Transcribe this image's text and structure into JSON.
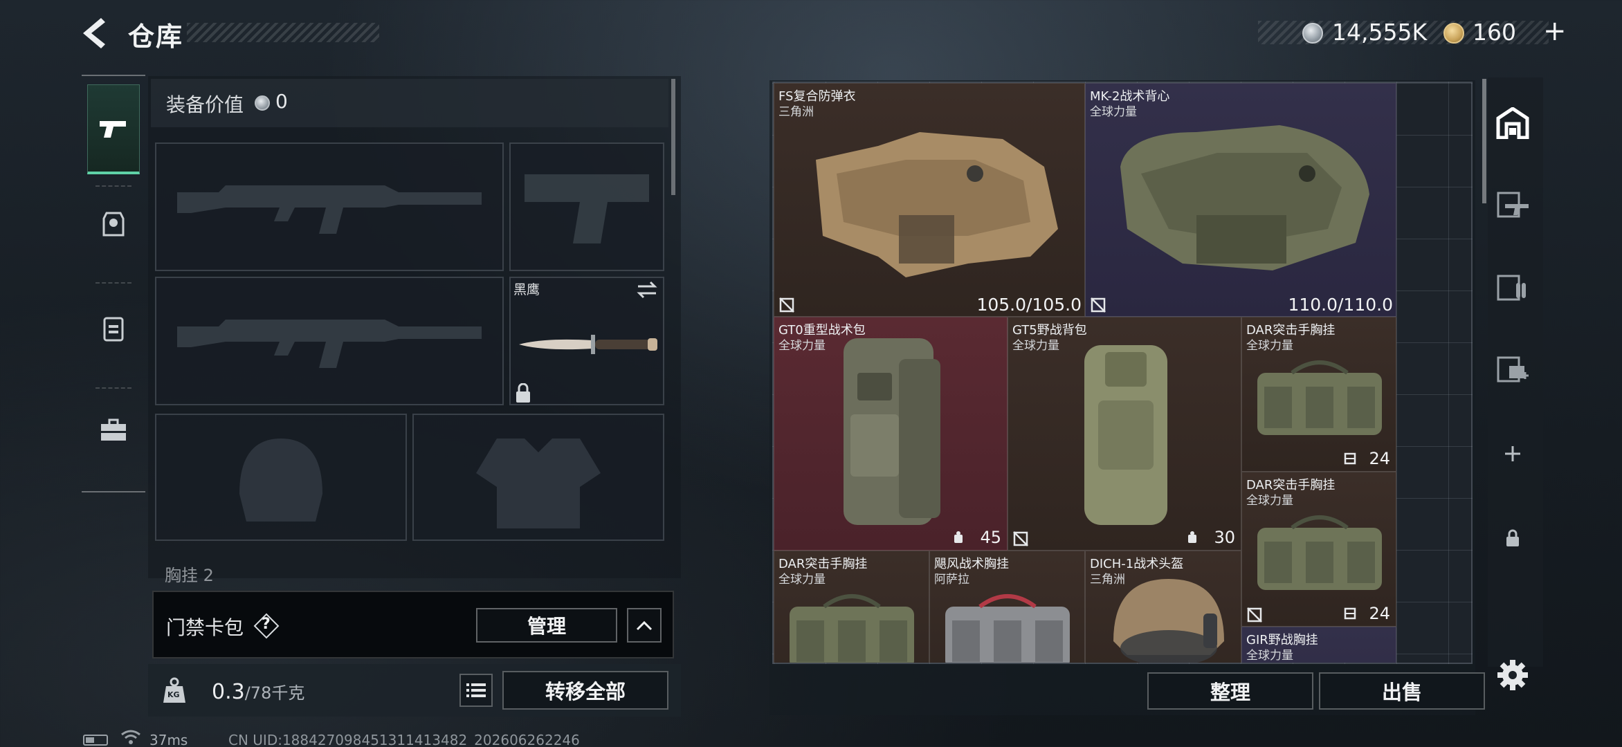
{
  "header": {
    "title": "仓库",
    "coins": "14,555K",
    "tokens": "160",
    "tokens_plus": "+"
  },
  "loadout": {
    "equip_value_label": "装备价值",
    "equip_value": "0",
    "knife_name": "黑鹰",
    "chest_rig_label": "胸挂 2",
    "card_bar_label": "门禁卡包",
    "card_help": "?",
    "manage_label": "管理"
  },
  "weight": {
    "current": "0.3",
    "max": "/78",
    "unit": "千克",
    "kg_badge": "KG",
    "transfer_all_label": "转移全部"
  },
  "storage": {
    "items": [
      {
        "name": "FS复合防弹衣",
        "sub": "三角洲",
        "value": "105.0/105.0"
      },
      {
        "name": "MK-2战术背心",
        "sub": "全球力量",
        "value": "110.0/110.0"
      },
      {
        "name": "GT0重型战术包",
        "sub": "全球力量",
        "value": "45"
      },
      {
        "name": "GT5野战背包",
        "sub": "全球力量",
        "value": "30"
      },
      {
        "name": "DAR突击手胸挂",
        "sub": "全球力量",
        "value": "24"
      },
      {
        "name": "DAR突击手胸挂",
        "sub": "全球力量",
        "value": "24"
      },
      {
        "name": "DAR突击手胸挂",
        "sub": "全球力量",
        "value": ""
      },
      {
        "name": "飓风战术胸挂",
        "sub": "阿萨拉",
        "value": ""
      },
      {
        "name": "DICH-1战术头盔",
        "sub": "三角洲",
        "value": ""
      },
      {
        "name": "GIR野战胸挂",
        "sub": "全球力量",
        "value": ""
      }
    ],
    "sort_label": "整理",
    "sell_label": "出售"
  },
  "status": {
    "ping": "37ms",
    "uid": "CN UID:1884270984513114134​82_202606262246"
  },
  "colors": {
    "accent_green": "#5fd1a6",
    "item_brown": "#3b2e28",
    "item_purple": "#33304a",
    "item_red": "#5a2a32"
  },
  "icons": {
    "rail": [
      "pistol-icon",
      "helmet-armor-icon",
      "backpack-icon",
      "toolbox-icon"
    ],
    "tools": [
      "warehouse-icon",
      "weapon-storage-icon",
      "ammo-storage-icon",
      "medical-storage-icon",
      "add-icon",
      "lock-icon"
    ]
  }
}
